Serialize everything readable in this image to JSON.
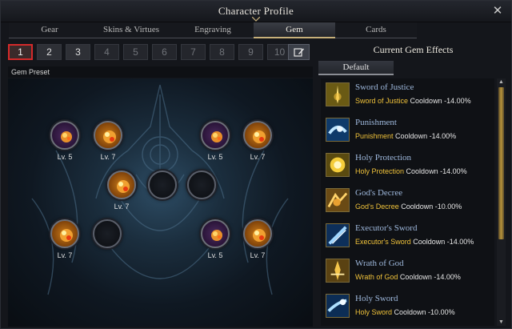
{
  "window": {
    "title": "Character Profile",
    "close_icon": "close-icon"
  },
  "tabs": [
    {
      "label": "Gear",
      "active": false
    },
    {
      "label": "Skins & Virtues",
      "active": false
    },
    {
      "label": "Engraving",
      "active": false
    },
    {
      "label": "Gem",
      "active": true
    },
    {
      "label": "Cards",
      "active": false
    }
  ],
  "presets": {
    "items": [
      "1",
      "2",
      "3",
      "4",
      "5",
      "6",
      "7",
      "8",
      "9",
      "10"
    ],
    "selected": "1",
    "available": [
      "1",
      "2",
      "3"
    ],
    "edit_icon": "edit-icon"
  },
  "gem_preset_label": "Gem Preset",
  "gems": [
    {
      "type": "purple",
      "level": "Lv. 5"
    },
    {
      "type": "amber",
      "level": "Lv. 7"
    },
    {
      "type": "purple",
      "level": "Lv. 5"
    },
    {
      "type": "amber",
      "level": "Lv. 7"
    },
    {
      "type": "amber",
      "level": "Lv. 7"
    },
    {
      "type": "empty",
      "level": ""
    },
    {
      "type": "empty",
      "level": ""
    },
    {
      "type": "amber",
      "level": "Lv. 7"
    },
    {
      "type": "empty",
      "level": ""
    },
    {
      "type": "purple",
      "level": "Lv. 5"
    },
    {
      "type": "amber",
      "level": "Lv. 7"
    }
  ],
  "effects_panel": {
    "title": "Current Gem Effects",
    "tab": "Default",
    "effects": [
      {
        "name": "Sword of Justice",
        "skill": "Sword of Justice",
        "effect": "Cooldown -14.00%",
        "icon": "sword-of-justice-icon"
      },
      {
        "name": "Punishment",
        "skill": "Punishment",
        "effect": "Cooldown -14.00%",
        "icon": "punishment-icon"
      },
      {
        "name": "Holy Protection",
        "skill": "Holy Protection",
        "effect": "Cooldown -14.00%",
        "icon": "holy-protection-icon"
      },
      {
        "name": "God's Decree",
        "skill": "God's Decree",
        "effect": "Cooldown -10.00%",
        "icon": "gods-decree-icon"
      },
      {
        "name": "Executor's Sword",
        "skill": "Executor's Sword",
        "effect": "Cooldown -14.00%",
        "icon": "executors-sword-icon"
      },
      {
        "name": "Wrath of God",
        "skill": "Wrath of God",
        "effect": "Cooldown -14.00%",
        "icon": "wrath-of-god-icon"
      },
      {
        "name": "Holy Sword",
        "skill": "Holy Sword",
        "effect": "Cooldown -10.00%",
        "icon": "holy-sword-icon"
      }
    ]
  },
  "colors": {
    "accent_gold": "#c7b07a",
    "skill_highlight": "#f0c23a",
    "selected_preset": "#d42a2a",
    "effect_name": "#9eb8dc"
  }
}
